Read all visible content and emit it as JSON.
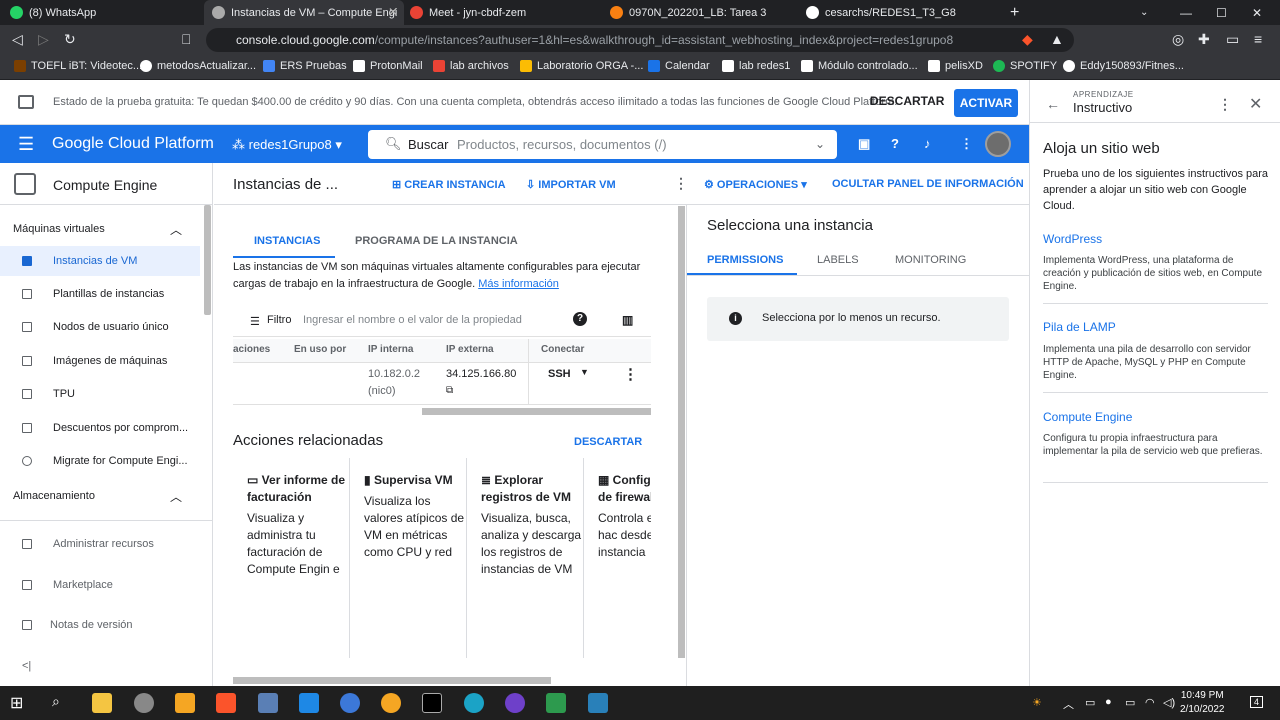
{
  "browser": {
    "tabs": [
      {
        "label": "(8) WhatsApp",
        "icon": "whatsapp-icon",
        "color": "#25d366"
      },
      {
        "label": "Instancias de VM – Compute Engi",
        "icon": "gcp-icon",
        "color": "#aaaaaa",
        "active": true
      },
      {
        "label": "Meet - jyn-cbdf-zem",
        "icon": "meet-icon",
        "color": "#ea4335"
      },
      {
        "label": "0970N_202201_LB: Tarea 3",
        "icon": "moodle-icon",
        "color": "#f98012"
      },
      {
        "label": "cesarchs/REDES1_T3_G8",
        "icon": "github-icon",
        "color": "#ffffff"
      }
    ],
    "new_tab": "+",
    "url_host": "console.cloud.google.com",
    "url_path": "/compute/instances?authuser=1&hl=es&walkthrough_id=assistant_webhosting_index&project=redes1grupo8",
    "bookmarks": [
      {
        "label": "TOEFL iBT: Videotec...",
        "color": "#7b3f00"
      },
      {
        "label": "metodosActualizar...",
        "color": "#ffffff"
      },
      {
        "label": "ERS Pruebas",
        "color": "#4285f4"
      },
      {
        "label": "ProtonMail",
        "color": "#ffffff"
      },
      {
        "label": "lab archivos",
        "color": "#ea4335"
      },
      {
        "label": "Laboratorio ORGA -...",
        "color": "#fbbc04"
      },
      {
        "label": "Calendar",
        "color": "#1a73e8"
      },
      {
        "label": "lab redes1",
        "color": "#ffffff"
      },
      {
        "label": "Módulo controlado...",
        "color": "#ffffff"
      },
      {
        "label": "pelisXD",
        "color": "#ffffff"
      },
      {
        "label": "SPOTIFY",
        "color": "#1db954"
      },
      {
        "label": "Eddy150893/Fitnes...",
        "color": "#ffffff"
      }
    ]
  },
  "banner": {
    "text": "Estado de la prueba gratuita: Te quedan $400.00 de crédito y 90 días. Con una cuenta completa, obtendrás acceso ilimitado a todas las funciones de Google Cloud Platform.",
    "dismiss": "DESCARTAR",
    "activate": "ACTIVAR"
  },
  "header": {
    "brand": "Google Cloud Platform",
    "project": "redes1Grupo8",
    "search_label": "Buscar",
    "search_placeholder": "Productos, recursos, documentos (/)"
  },
  "nav": {
    "product": "Compute Engine",
    "section_vm": "Máquinas virtuales",
    "items": [
      "Instancias de VM",
      "Plantillas de instancias",
      "Nodos de usuario único",
      "Imágenes de máquinas",
      "TPU",
      "Descuentos por comprom...",
      "Migrate for Compute Engi..."
    ],
    "section_storage": "Almacenamiento",
    "bottom": [
      "Administrar recursos",
      "Marketplace",
      "Notas de versión"
    ],
    "collapse": "<|"
  },
  "main": {
    "title": "Instancias de ...",
    "create": "CREAR INSTANCIA",
    "import": "IMPORTAR VM",
    "operations": "OPERACIONES",
    "hide_panel": "OCULTAR PANEL DE INFORMACIÓN",
    "tabs": [
      "INSTANCIAS",
      "PROGRAMA DE LA INSTANCIA"
    ],
    "desc": "Las instancias de VM son máquinas virtuales altamente configurables para ejecutar cargas de trabajo en la infraestructura de Google.",
    "more_info": "Más información",
    "filter_label": "Filtro",
    "filter_placeholder": "Ingresar el nombre o el valor de la propiedad",
    "columns": [
      "aciones",
      "En uso por",
      "IP interna",
      "IP externa",
      "Conectar"
    ],
    "row": {
      "ip_internal": "10.182.0.2",
      "nic": "(nic0)",
      "ip_external": "34.125.166.80",
      "connect": "SSH"
    },
    "related_title": "Acciones relacionadas",
    "related_dismiss": "DESCARTAR",
    "cards": [
      {
        "title": "Ver informe de facturación",
        "desc": "Visualiza y administra tu facturación de Compute Engin e"
      },
      {
        "title": "Supervisa VM",
        "desc": "Visualiza los valores atípicos de VM en métricas como CPU y red"
      },
      {
        "title": "Explorar registros de VM",
        "desc": "Visualiza, busca, analiza y descarga los registros de instancias de VM"
      },
      {
        "title": "Config reglas de firewall",
        "desc": "Controla e tráfico hac desde una instancia"
      }
    ]
  },
  "info": {
    "title": "Selecciona una instancia",
    "tabs": [
      "PERMISSIONS",
      "LABELS",
      "MONITORING"
    ],
    "notice": "Selecciona por lo menos un recurso."
  },
  "tutorial": {
    "caption": "APRENDIZAJE",
    "title": "Instructivo",
    "heading": "Aloja un sitio web",
    "intro": "Prueba uno de los siguientes instructivos para aprender a alojar un sitio web con Google Cloud.",
    "options": [
      {
        "title": "WordPress",
        "desc": "Implementa WordPress, una plataforma de creación y publicación de sitios web, en Compute Engine."
      },
      {
        "title": "Pila de LAMP",
        "desc": "Implementa una pila de desarrollo con servidor HTTP de Apache, MySQL y PHP en Compute Engine."
      },
      {
        "title": "Compute Engine",
        "desc": "Configura tu propia infraestructura para implementar la pila de servicio web que prefieras."
      }
    ]
  },
  "taskbar": {
    "time": "10:49 PM",
    "date": "2/10/2022",
    "notifications": "4"
  }
}
